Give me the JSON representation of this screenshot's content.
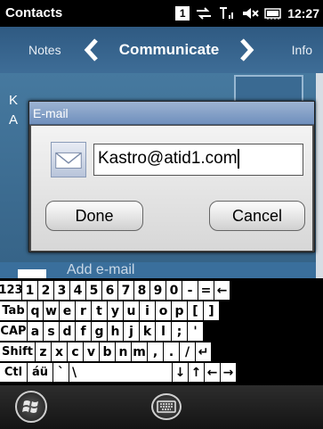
{
  "status": {
    "title": "Contacts",
    "badge": "1",
    "time": "12:27",
    "icons": [
      "sync-icon",
      "signal-icon",
      "volume-mute-icon",
      "battery-icon"
    ]
  },
  "pivot": {
    "left": "Notes",
    "center": "Communicate",
    "right": "Info"
  },
  "background": {
    "name_line1": "K",
    "name_line2": "A",
    "add_email": "Add e-mail"
  },
  "dialog": {
    "title": "E-mail",
    "email_value": "Kastro@atid1.com",
    "done_label": "Done",
    "cancel_label": "Cancel"
  },
  "keyboard": {
    "rows": [
      [
        "123",
        "1",
        "2",
        "3",
        "4",
        "5",
        "6",
        "7",
        "8",
        "9",
        "0",
        "-",
        "=",
        "←"
      ],
      [
        "Tab",
        "q",
        "w",
        "e",
        "r",
        "t",
        "y",
        "u",
        "i",
        "o",
        "p",
        "[",
        "]"
      ],
      [
        "CAP",
        "a",
        "s",
        "d",
        "f",
        "g",
        "h",
        "j",
        "k",
        "l",
        ";",
        "'"
      ],
      [
        "Shift",
        "z",
        "x",
        "c",
        "v",
        "b",
        "n",
        "m",
        ",",
        ".",
        "/",
        "↵"
      ],
      [
        "Ctl",
        "áü",
        "`",
        "\\",
        "↓",
        "↑",
        "←",
        "→"
      ]
    ]
  },
  "colors": {
    "pivot_bg": "#2f5a82",
    "dialog_title": "#7f9dc6",
    "keyboard_bg": "#000000"
  }
}
